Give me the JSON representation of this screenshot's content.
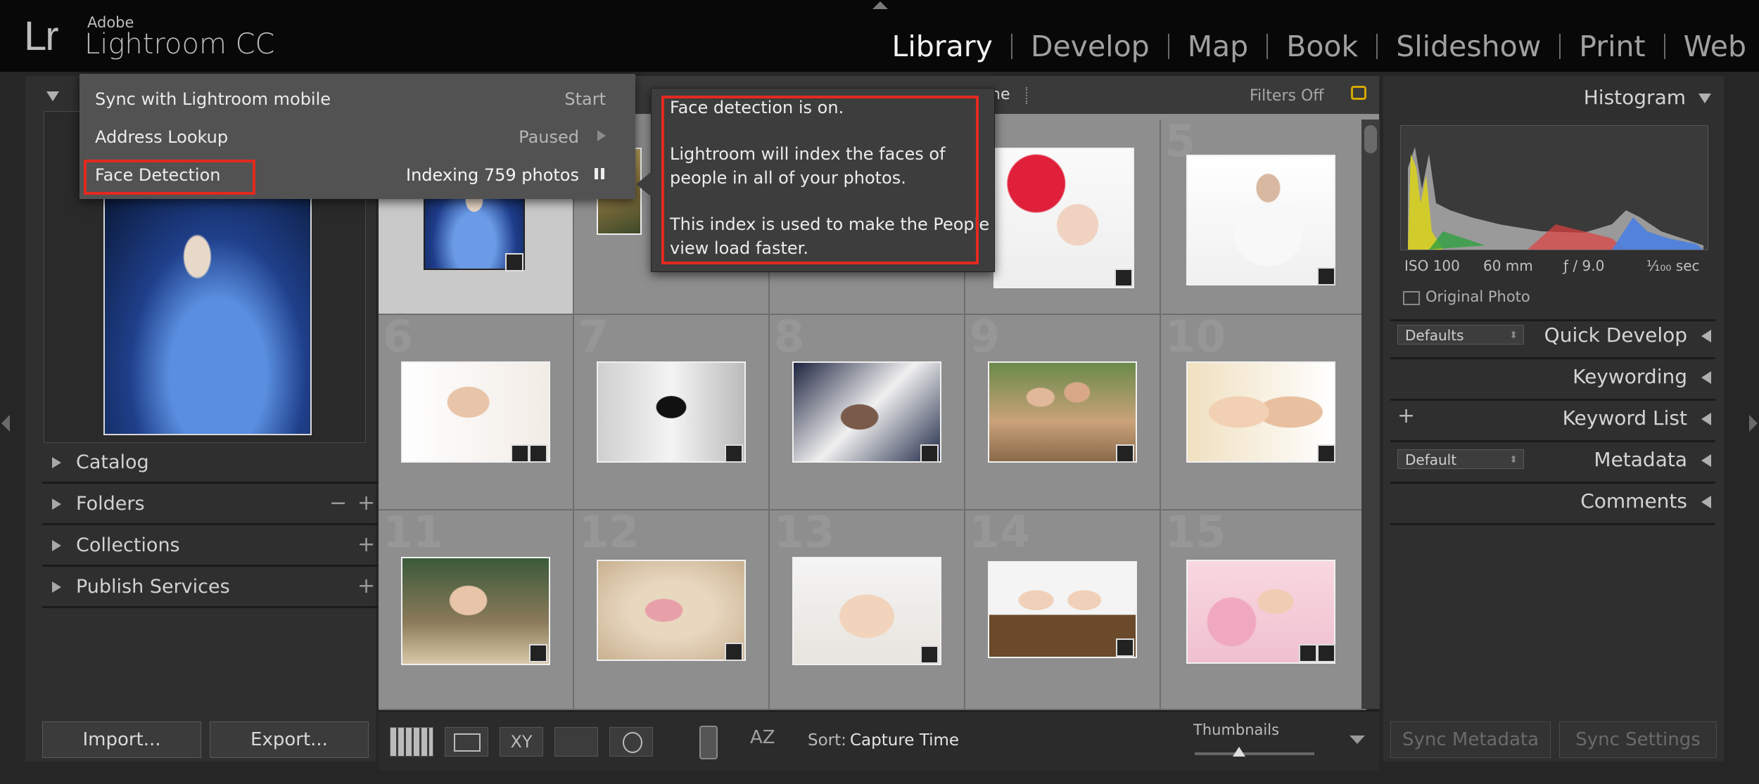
{
  "app": {
    "brand_short": "Lr",
    "vendor": "Adobe",
    "product": "Lightroom CC"
  },
  "modules": [
    "Library",
    "Develop",
    "Map",
    "Book",
    "Slideshow",
    "Print",
    "Web"
  ],
  "active_module": "Library",
  "left_panel": {
    "sections": [
      {
        "label": "Catalog"
      },
      {
        "label": "Folders"
      },
      {
        "label": "Collections"
      },
      {
        "label": "Publish Services"
      }
    ],
    "import_label": "Import...",
    "export_label": "Export..."
  },
  "filter_bar": {
    "partial_label": "ne",
    "filters_label": "Filters Off"
  },
  "popup_menu": {
    "items": [
      {
        "label": "Sync with Lightroom mobile",
        "value": "Start"
      },
      {
        "label": "Address Lookup",
        "value": "Paused"
      },
      {
        "label": "Face Detection",
        "value": "Indexing 759 photos"
      }
    ]
  },
  "tooltip": {
    "line1": "Face detection is on.",
    "line2": "Lightroom will index the faces of",
    "line3": "people in all of your photos.",
    "line4": "This index is used to make the People",
    "line5": "view load faster."
  },
  "grid": {
    "cell_numbers": [
      "6",
      "7",
      "8",
      "9",
      "10",
      "11",
      "12",
      "13",
      "14",
      "15",
      "5"
    ]
  },
  "toolbar": {
    "sort_label": "Sort:",
    "sort_value": "Capture Time",
    "thumbnails_label": "Thumbnails"
  },
  "right_panel": {
    "histogram_label": "Histogram",
    "iso": "ISO 100",
    "focal": "60 mm",
    "aperture": "ƒ / 9.0",
    "shutter": "¹⁄₁₀₀ sec",
    "original_photo": "Original Photo",
    "quick_develop_preset": "Defaults",
    "quick_develop": "Quick Develop",
    "keywording": "Keywording",
    "keyword_list": "Keyword List",
    "metadata_preset": "Default",
    "metadata": "Metadata",
    "comments": "Comments",
    "sync_metadata": "Sync Metadata",
    "sync_settings": "Sync Settings"
  },
  "colors": {
    "highlight": "#e3291e",
    "panel": "#2f2f2f",
    "grid_bg": "#8f8f8f"
  }
}
